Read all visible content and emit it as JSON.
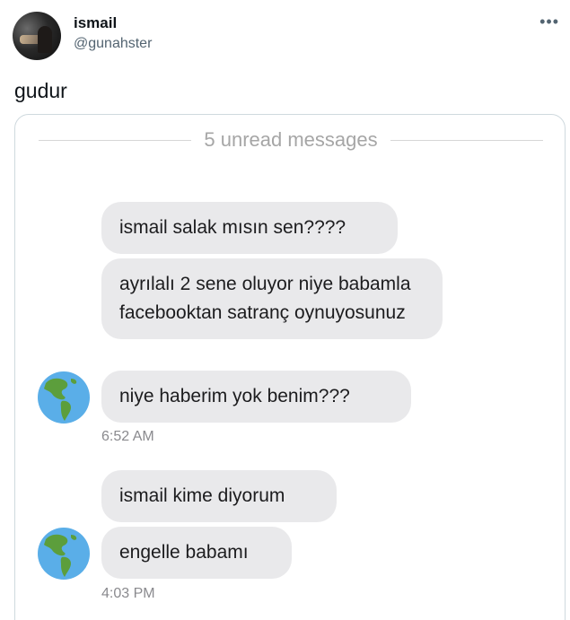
{
  "author": {
    "display_name": "ismail",
    "handle": "@gunahster"
  },
  "more_icon": "more-icon",
  "tweet_text": "gudur",
  "media": {
    "unread_label": "5 unread messages",
    "groups": [
      {
        "messages": [
          "ismail salak mısın sen????",
          "ayrılalı 2 sene oluyor niye babamla facebooktan satranç oynuyosunuz",
          "niye haberim yok benim???"
        ],
        "time": "6:52 AM",
        "avatar_icon": "globe-americas-icon"
      },
      {
        "messages": [
          "ismail kime diyorum",
          "engelle babamı"
        ],
        "time": "4:03 PM",
        "avatar_icon": "globe-americas-icon"
      }
    ]
  },
  "colors": {
    "bubble": "#e9e9eb",
    "ocean": "#5aaee8",
    "land": "#5c9e3c",
    "timestamp": "#8a8a8e"
  }
}
